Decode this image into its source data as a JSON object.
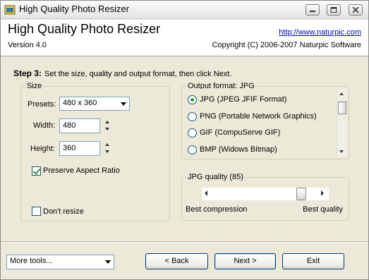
{
  "window": {
    "title": "High Quality Photo Resizer",
    "controls": {
      "minimize": "minimize",
      "maximize": "maximize",
      "close": "close"
    }
  },
  "header": {
    "app_title": "High Quality Photo Resizer",
    "version": "Version 4.0",
    "website": "http://www.naturpic.com",
    "copyright": "Copyright (C) 2006-2007 Naturpic Software"
  },
  "step": {
    "label": "Step 3:",
    "instruction": "Set the size, quality and output format, then click Next."
  },
  "size": {
    "group_label": "Size",
    "presets_label": "Presets:",
    "preset_value": "480 x 360",
    "width_label": "Width:",
    "width_value": "480",
    "height_label": "Height:",
    "height_value": "360",
    "preserve_label": "Preserve Aspect Ratio",
    "preserve_checked": true,
    "dont_resize_label": "Don't resize",
    "dont_resize_checked": false
  },
  "output": {
    "group_label": "Output format: JPG",
    "formats": [
      {
        "label": "JPG (JPEG JFIF Format)",
        "selected": true
      },
      {
        "label": "PNG (Portable Network Graphics)",
        "selected": false
      },
      {
        "label": "GIF (CompuServe GIF)",
        "selected": false
      },
      {
        "label": "BMP (Widows Bitmap)",
        "selected": false
      }
    ]
  },
  "quality": {
    "group_label": "JPG quality (85)",
    "value": 85,
    "min_label": "Best compression",
    "max_label": "Best quality"
  },
  "footer": {
    "more_tools": "More tools...",
    "back": "< Back",
    "next": "Next >",
    "exit": "Exit"
  },
  "colors": {
    "accent_check": "#21a121",
    "link": "#0000cc",
    "window_bg": "#ece9d8"
  }
}
